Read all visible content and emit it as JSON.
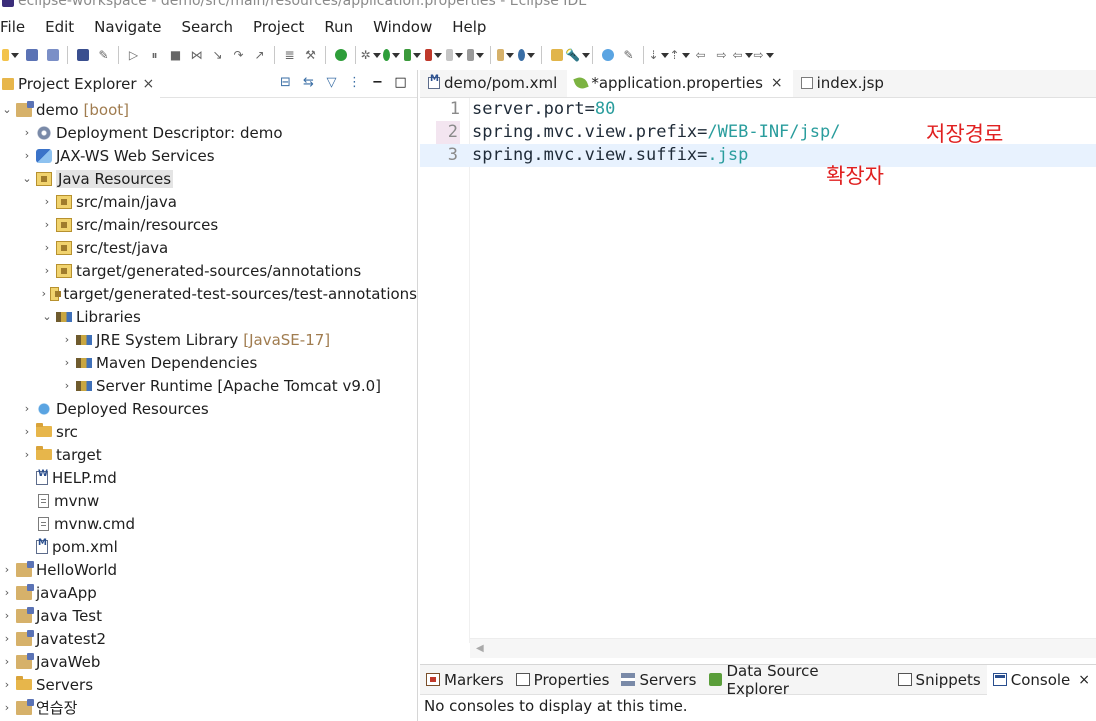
{
  "window": {
    "title": "eclipse-workspace - demo/src/main/resources/application.properties - Eclipse IDE"
  },
  "menu": [
    "File",
    "Edit",
    "Navigate",
    "Search",
    "Project",
    "Run",
    "Window",
    "Help"
  ],
  "explorer": {
    "tab_label": "Project Explorer",
    "close_glyph": "×",
    "nodes": [
      {
        "label": "demo",
        "deco": "[boot]",
        "indent": 0,
        "arrow": "v",
        "icon": "proj"
      },
      {
        "label": "Deployment Descriptor: demo",
        "deco": "",
        "indent": 1,
        "arrow": ">",
        "icon": "gear"
      },
      {
        "label": "JAX-WS Web Services",
        "deco": "",
        "indent": 1,
        "arrow": ">",
        "icon": "ws"
      },
      {
        "label": "Java Resources",
        "deco": "",
        "indent": 1,
        "arrow": "v",
        "icon": "pkg",
        "selected": true
      },
      {
        "label": "src/main/java",
        "deco": "",
        "indent": 2,
        "arrow": ">",
        "icon": "pkg"
      },
      {
        "label": "src/main/resources",
        "deco": "",
        "indent": 2,
        "arrow": ">",
        "icon": "pkg"
      },
      {
        "label": "src/test/java",
        "deco": "",
        "indent": 2,
        "arrow": ">",
        "icon": "pkg"
      },
      {
        "label": "target/generated-sources/annotations",
        "deco": "",
        "indent": 2,
        "arrow": ">",
        "icon": "pkg"
      },
      {
        "label": "target/generated-test-sources/test-annotations",
        "deco": "",
        "indent": 2,
        "arrow": ">",
        "icon": "pkg"
      },
      {
        "label": "Libraries",
        "deco": "",
        "indent": 2,
        "arrow": "v",
        "icon": "lib"
      },
      {
        "label": "JRE System Library",
        "deco": "[JavaSE-17]",
        "indent": 3,
        "arrow": ">",
        "icon": "lib"
      },
      {
        "label": "Maven Dependencies",
        "deco": "",
        "indent": 3,
        "arrow": ">",
        "icon": "lib"
      },
      {
        "label": "Server Runtime [Apache Tomcat v9.0]",
        "deco": "",
        "indent": 3,
        "arrow": ">",
        "icon": "lib"
      },
      {
        "label": "Deployed Resources",
        "deco": "",
        "indent": 1,
        "arrow": ">",
        "icon": "globe"
      },
      {
        "label": "src",
        "deco": "",
        "indent": 1,
        "arrow": ">",
        "icon": "folder"
      },
      {
        "label": "target",
        "deco": "",
        "indent": 1,
        "arrow": ">",
        "icon": "folder"
      },
      {
        "label": "HELP.md",
        "deco": "",
        "indent": 1,
        "arrow": "",
        "icon": "w"
      },
      {
        "label": "mvnw",
        "deco": "",
        "indent": 1,
        "arrow": "",
        "icon": "file"
      },
      {
        "label": "mvnw.cmd",
        "deco": "",
        "indent": 1,
        "arrow": "",
        "icon": "file"
      },
      {
        "label": "pom.xml",
        "deco": "",
        "indent": 1,
        "arrow": "",
        "icon": "m"
      },
      {
        "label": "HelloWorld",
        "deco": "",
        "indent": 0,
        "arrow": ">",
        "icon": "proj"
      },
      {
        "label": "javaApp",
        "deco": "",
        "indent": 0,
        "arrow": ">",
        "icon": "proj"
      },
      {
        "label": "Java Test",
        "deco": "",
        "indent": 0,
        "arrow": ">",
        "icon": "proj"
      },
      {
        "label": "Javatest2",
        "deco": "",
        "indent": 0,
        "arrow": ">",
        "icon": "proj"
      },
      {
        "label": "JavaWeb",
        "deco": "",
        "indent": 0,
        "arrow": ">",
        "icon": "proj"
      },
      {
        "label": "Servers",
        "deco": "",
        "indent": 0,
        "arrow": ">",
        "icon": "folder"
      },
      {
        "label": "연습장",
        "deco": "",
        "indent": 0,
        "arrow": ">",
        "icon": "proj"
      }
    ]
  },
  "editor": {
    "tabs": [
      {
        "label": "demo/pom.xml",
        "icon": "m",
        "active": false
      },
      {
        "label": "*application.properties",
        "icon": "leaf",
        "active": true
      },
      {
        "label": "index.jsp",
        "icon": "doc",
        "active": false
      }
    ],
    "close_glyph": "×",
    "lines": [
      {
        "num": "1",
        "key": "server.port=",
        "value": "80"
      },
      {
        "num": "2",
        "key": "spring.mvc.view.prefix=",
        "value": "/WEB-INF/jsp/"
      },
      {
        "num": "3",
        "key": "spring.mvc.view.suffix=",
        "value": ".jsp"
      }
    ],
    "annotations": {
      "prefix_note": "저장경로",
      "suffix_note": "확장자"
    }
  },
  "bottom_panel": {
    "tabs": [
      {
        "label": "Markers",
        "icon": "markers"
      },
      {
        "label": "Properties",
        "icon": "props"
      },
      {
        "label": "Servers",
        "icon": "servers"
      },
      {
        "label": "Data Source Explorer",
        "icon": "dse"
      },
      {
        "label": "Snippets",
        "icon": "snip"
      },
      {
        "label": "Console",
        "icon": "console",
        "active": true
      }
    ],
    "message": "No consoles to display at this time."
  }
}
